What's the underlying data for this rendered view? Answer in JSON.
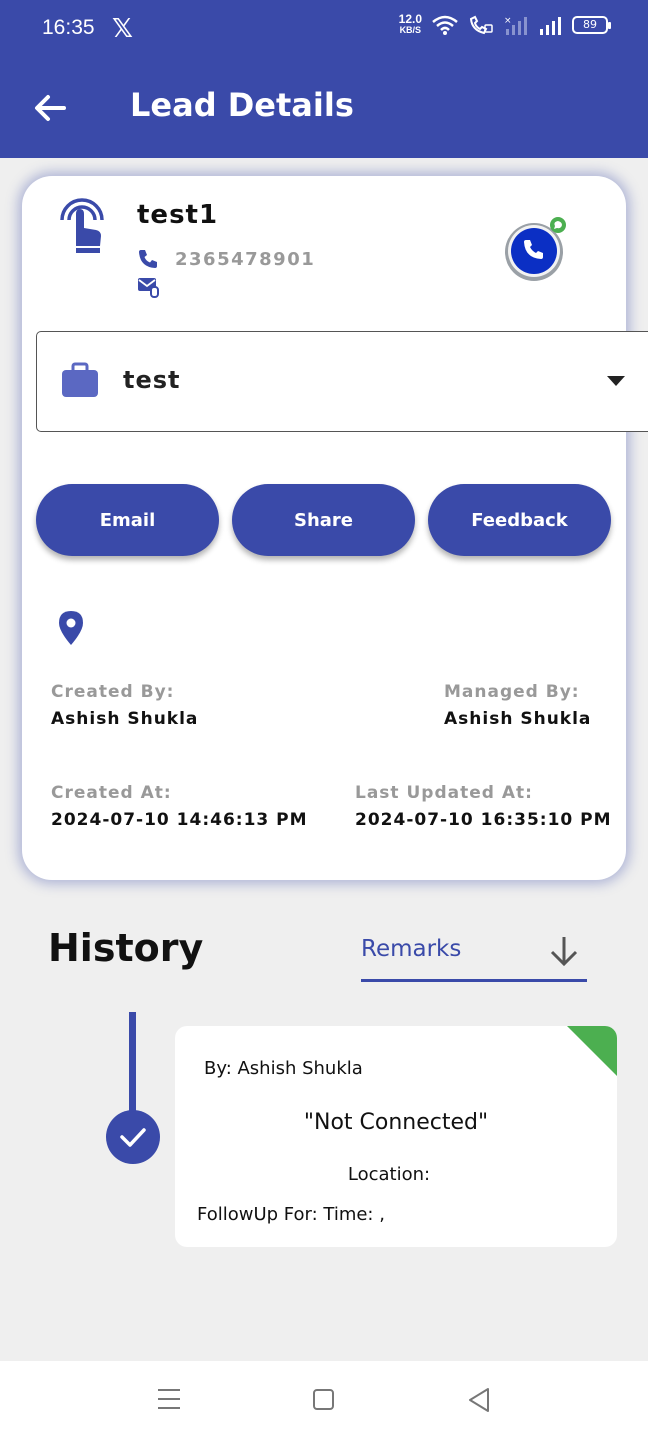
{
  "status_bar": {
    "time": "16:35",
    "net_speed_value": "12.0",
    "net_speed_unit": "KB/S",
    "battery": "89"
  },
  "app_bar": {
    "title": "Lead Details"
  },
  "lead": {
    "name": "test1",
    "phone": "2365478901",
    "category": "test"
  },
  "actions": {
    "email": "Email",
    "share": "Share",
    "feedback": "Feedback"
  },
  "info": {
    "created_by_label": "Created By:",
    "created_by": "Ashish Shukla",
    "managed_by_label": "Managed By:",
    "managed_by": "Ashish Shukla",
    "created_at_label": "Created At:",
    "created_at": "2024-07-10 14:46:13 PM",
    "updated_at_label": "Last Updated At:",
    "updated_at": "2024-07-10 16:35:10 PM"
  },
  "history": {
    "title": "History",
    "filter": "Remarks",
    "entries": [
      {
        "by": "By: Ashish Shukla",
        "status": "\"Not Connected\"",
        "location": "Location:",
        "followup": "FollowUp For:   Time: ,"
      }
    ]
  },
  "colors": {
    "primary": "#3a4aa9",
    "accent_green": "#4caf50",
    "background": "#efefef"
  },
  "icons": [
    "x-icon",
    "wifi-icon",
    "signal-icon",
    "battery-icon",
    "back-arrow-icon",
    "tap-icon",
    "phone-icon",
    "mail-icon",
    "call-whatsapp-icon",
    "briefcase-icon",
    "chevron-down-icon",
    "location-pin-icon",
    "arrow-down-icon",
    "check-icon",
    "nav-menu-icon",
    "nav-home-icon",
    "nav-back-icon"
  ]
}
